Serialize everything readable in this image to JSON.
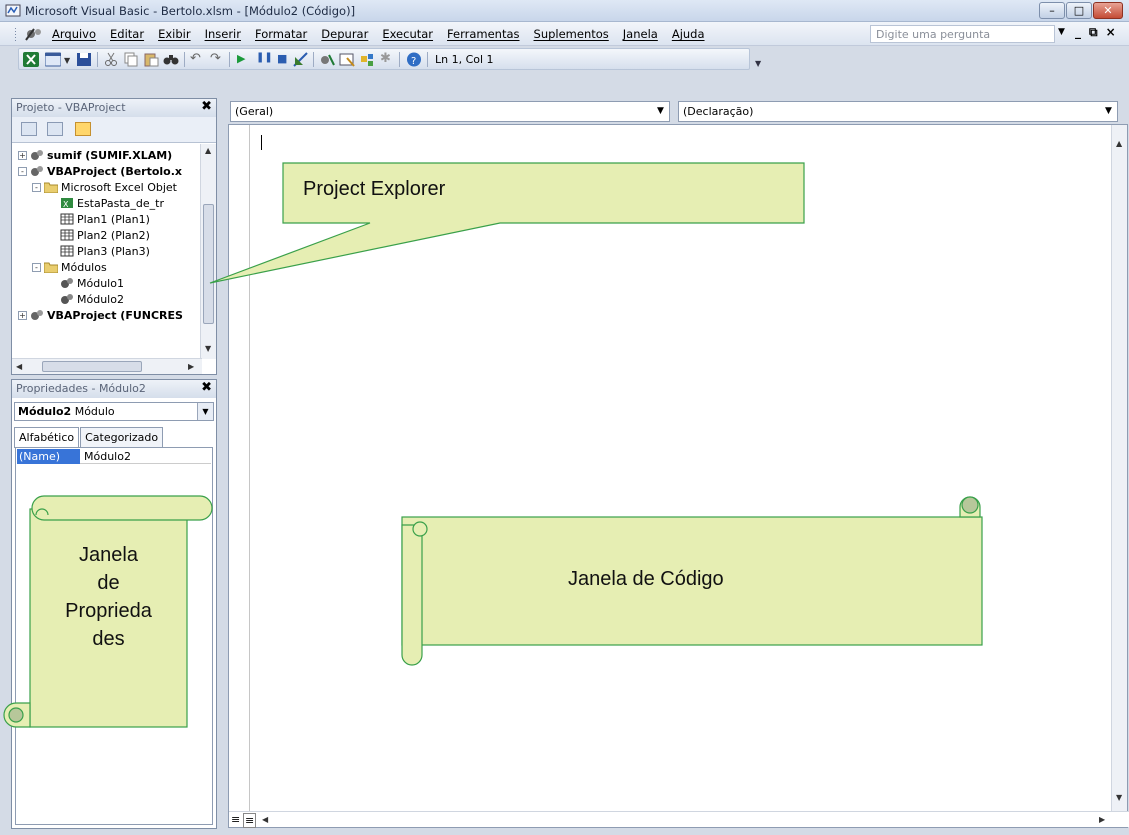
{
  "window": {
    "title": "Microsoft Visual Basic - Bertolo.xlsm - [Módulo2 (Código)]"
  },
  "menu": {
    "items": [
      "Arquivo",
      "Editar",
      "Exibir",
      "Inserir",
      "Formatar",
      "Depurar",
      "Executar",
      "Ferramentas",
      "Suplementos",
      "Janela",
      "Ajuda"
    ],
    "question_placeholder": "Digite uma pergunta"
  },
  "toolbar": {
    "position": "Ln 1, Col 1"
  },
  "project_panel": {
    "title": "Projeto - VBAProject",
    "tree": [
      {
        "label": "sumif (SUMIF.XLAM)",
        "bold": true,
        "icon": "vba-project-icon"
      },
      {
        "label": "VBAProject (Bertolo.x",
        "bold": true,
        "icon": "vba-project-icon"
      },
      {
        "label": "Microsoft Excel Objet",
        "bold": false,
        "icon": "folder-icon"
      },
      {
        "label": "EstaPasta_de_tr",
        "bold": false,
        "icon": "workbook-icon"
      },
      {
        "label": "Plan1 (Plan1)",
        "bold": false,
        "icon": "sheet-icon"
      },
      {
        "label": "Plan2 (Plan2)",
        "bold": false,
        "icon": "sheet-icon"
      },
      {
        "label": "Plan3 (Plan3)",
        "bold": false,
        "icon": "sheet-icon"
      },
      {
        "label": "Módulos",
        "bold": false,
        "icon": "folder-icon"
      },
      {
        "label": "Módulo1",
        "bold": false,
        "icon": "module-icon"
      },
      {
        "label": "Módulo2",
        "bold": false,
        "icon": "module-icon"
      },
      {
        "label": "VBAProject (FUNCRES",
        "bold": true,
        "icon": "vba-project-icon"
      }
    ]
  },
  "properties_panel": {
    "title": "Propriedades - Módulo2",
    "object_name": "Módulo2",
    "object_type": "Módulo",
    "tabs": [
      "Alfabético",
      "Categorizado"
    ],
    "property_name": "(Name)",
    "property_value": "Módulo2"
  },
  "code_window": {
    "object_combo": "(Geral)",
    "procedure_combo": "(Declaração)"
  },
  "callouts": {
    "project_explorer": "Project Explorer",
    "properties_line1": "Janela",
    "properties_line2": "de",
    "properties_line3": "Proprieda",
    "properties_line4": "des",
    "code": "Janela de Código"
  },
  "colors": {
    "callout_fill": "#e6eeb3",
    "callout_border": "#3aa04a",
    "selection": "#3874d8"
  }
}
